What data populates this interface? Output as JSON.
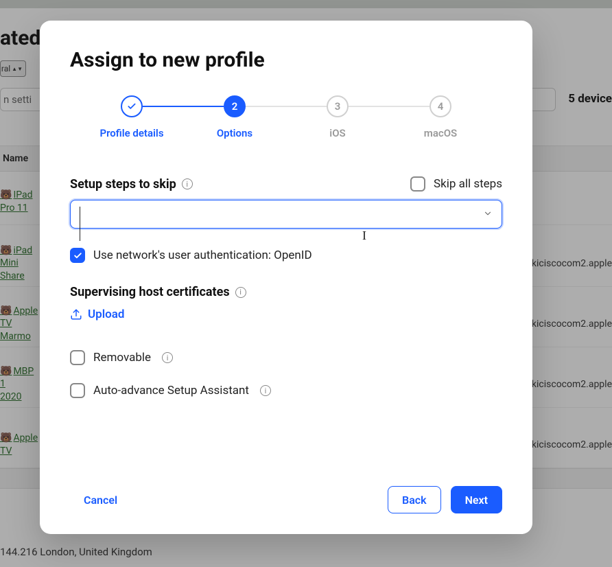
{
  "background": {
    "title_fragment": "ated",
    "select_fragment": "ral",
    "search_fragment": "n setti",
    "device_count": "5 device",
    "table_header": "Name",
    "rows": [
      {
        "name_line1": "IPad",
        "name_line2": "Pro 11",
        "enroll": ""
      },
      {
        "name_line1": "iPad",
        "name_line2": "Mini Share",
        "enroll": "kiciscocom2.apple"
      },
      {
        "name_line1": "Apple",
        "name_line2": "TV Marmo",
        "enroll": "kiciscocom2.apple"
      },
      {
        "name_line1": "MBP 1",
        "name_line2": "2020",
        "enroll": "kiciscocom2.apple"
      },
      {
        "name_line1": "Apple",
        "name_line2": "TV",
        "enroll": "kiciscocom2.apple"
      }
    ],
    "footer": "144.216 London, United Kingdom"
  },
  "modal": {
    "title": "Assign to new profile",
    "steps": [
      {
        "label": "Profile details",
        "state": "done"
      },
      {
        "label": "Options",
        "state": "active",
        "num": "2"
      },
      {
        "label": "iOS",
        "state": "pending",
        "num": "3"
      },
      {
        "label": "macOS",
        "state": "pending",
        "num": "4"
      }
    ],
    "setup_label": "Setup steps to skip",
    "skip_all_label": "Skip all steps",
    "skip_all_checked": false,
    "dropdown_value": "",
    "network_auth_label": "Use network's user authentication: OpenID",
    "network_auth_checked": true,
    "certs_label": "Supervising host certificates",
    "upload_label": "Upload",
    "removable_label": "Removable",
    "removable_checked": false,
    "autoadvance_label": "Auto-advance Setup Assistant",
    "autoadvance_checked": false,
    "cancel_label": "Cancel",
    "back_label": "Back",
    "next_label": "Next"
  }
}
